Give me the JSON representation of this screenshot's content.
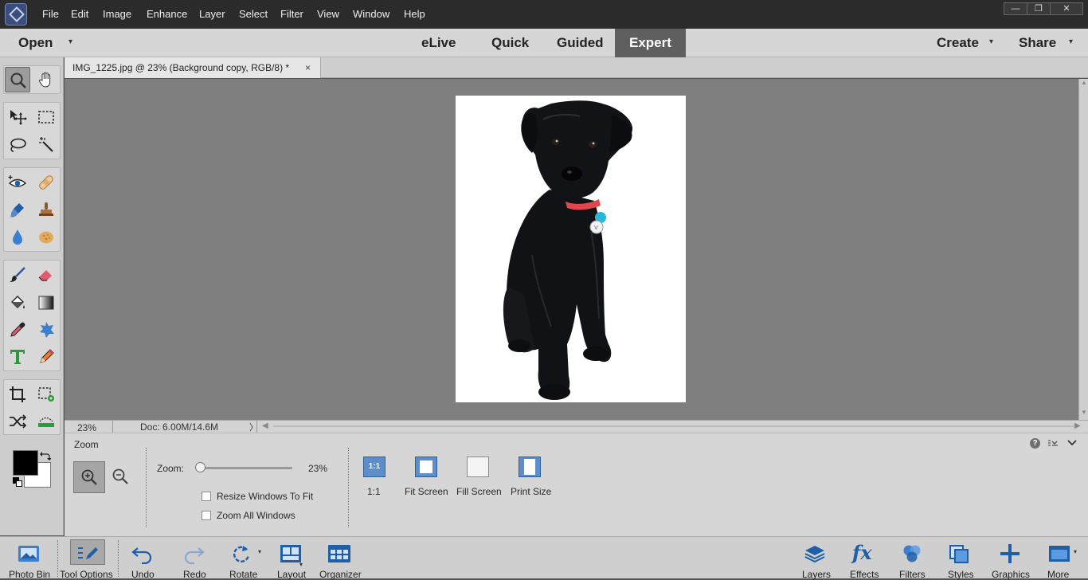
{
  "menubar": {
    "items": [
      "File",
      "Edit",
      "Image",
      "Enhance",
      "Layer",
      "Select",
      "Filter",
      "View",
      "Window",
      "Help"
    ],
    "window_controls": [
      "—",
      "❐",
      "✕"
    ]
  },
  "modebar": {
    "open_label": "Open",
    "modes": [
      "eLive",
      "Quick",
      "Guided",
      "Expert"
    ],
    "active_mode": "Expert",
    "create_label": "Create",
    "share_label": "Share"
  },
  "document": {
    "tab_title": "IMG_1225.jpg @ 23% (Background copy, RGB/8) *",
    "close_glyph": "×"
  },
  "statusbar": {
    "zoom": "23%",
    "doc_size": "Doc: 6.00M/14.6M",
    "arrow": "〉"
  },
  "tool_options": {
    "tool_name": "Zoom",
    "zoom_label": "Zoom:",
    "zoom_value": "23%",
    "zoom_slider_level": 0.05,
    "resize_windows_label": "Resize Windows To Fit",
    "resize_windows_checked": false,
    "zoom_all_label": "Zoom All Windows",
    "zoom_all_checked": false,
    "presets": [
      {
        "label": "1:1",
        "icon_text": "1:1"
      },
      {
        "label": "Fit Screen"
      },
      {
        "label": "Fill Screen"
      },
      {
        "label": "Print Size"
      }
    ],
    "help_glyph": "?"
  },
  "taskbar": {
    "left": [
      {
        "label": "Photo Bin",
        "icon": "photo-bin-icon"
      },
      {
        "label": "Tool Options",
        "icon": "tool-options-icon"
      },
      {
        "label": "Undo",
        "icon": "undo-icon"
      },
      {
        "label": "Redo",
        "icon": "redo-icon"
      },
      {
        "label": "Rotate",
        "icon": "rotate-icon"
      },
      {
        "label": "Layout",
        "icon": "layout-icon"
      },
      {
        "label": "Organizer",
        "icon": "organizer-icon"
      }
    ],
    "right": [
      {
        "label": "Layers",
        "icon": "layers-icon"
      },
      {
        "label": "Effects",
        "icon": "effects-icon"
      },
      {
        "label": "Filters",
        "icon": "filters-icon"
      },
      {
        "label": "Styles",
        "icon": "styles-icon"
      },
      {
        "label": "Graphics",
        "icon": "graphics-icon"
      },
      {
        "label": "More",
        "icon": "more-icon"
      }
    ],
    "effects_icon_text": "fx"
  },
  "colors": {
    "accent_blue": "#1f5fa8",
    "active_mode_bg": "#5f5f5f",
    "dog_collar": "#e0464b",
    "dog_tag": "#29b6d8"
  }
}
